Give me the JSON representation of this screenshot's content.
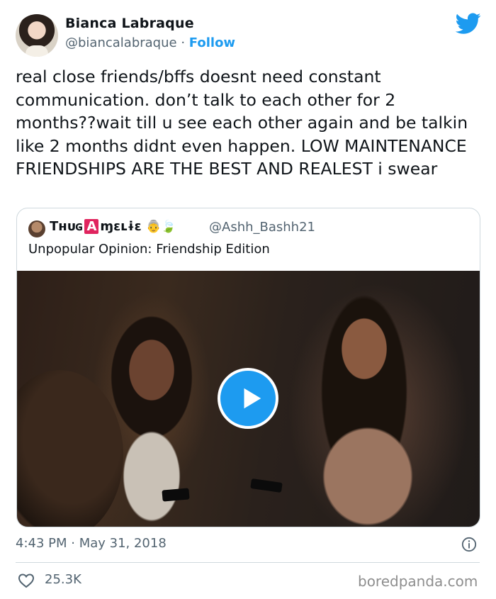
{
  "author": {
    "name": "Bianca Labraque",
    "handle": "@biancalabraque",
    "separator": "·",
    "follow_label": "Follow"
  },
  "tweet_text": "real close friends/bffs doesnt need constant communication. don’t talk to each other for 2 months??wait till u see each other again and be talkin like 2 months didnt even happen. LOW MAINTENANCE FRIENDSHIPS ARE THE BEST AND REALEST i swear",
  "quoted": {
    "name_part1": "Tʜᴜɢ",
    "name_part2": "A",
    "name_part3": "ɱɛʟɨɛ",
    "emojis": "👵🍃",
    "handle": "@Ashh_Bashh21",
    "text": "Unpopular Opinion: Friendship Edition"
  },
  "meta": {
    "time": "4:43 PM · May 31, 2018"
  },
  "likes": "25.3K",
  "watermark": "boredpanda.com",
  "colors": {
    "accent": "#1d9bf0",
    "muted": "#536471",
    "border": "#cfd9de"
  },
  "icons": [
    "twitter-bird-icon",
    "play-icon",
    "info-icon",
    "heart-icon"
  ]
}
